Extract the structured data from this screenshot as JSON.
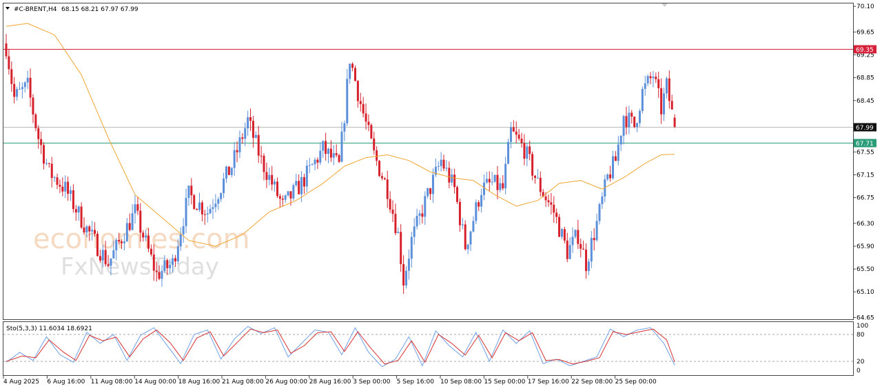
{
  "header": {
    "symbol_label": "#C-BRENT,H4",
    "ohlc_label": "68.15 68.21 67.97 67.99"
  },
  "oscillator": {
    "label": "Sto(5,3,3) 11.6034 18.6921",
    "levels": [
      "80",
      "20"
    ],
    "scale_labels": [
      "100",
      "80",
      "20",
      "0"
    ]
  },
  "watermark": {
    "brand": "economies.com",
    "sub": "FxNewsToday"
  },
  "colors": {
    "bull": "#5b8fd9",
    "bear": "#d6202b",
    "ma": "#f0a531",
    "stoch_main": "#6fa0e6",
    "stoch_signal": "#d63030",
    "resistance": "#d6213a",
    "support": "#2a9d78",
    "current": "#111111"
  },
  "chart_data": {
    "type": "candlestick",
    "instrument": "#C-BRENT",
    "timeframe": "H4",
    "y_ticks": [
      "70.10",
      "69.65",
      "69.25",
      "68.85",
      "68.45",
      "67.55",
      "67.15",
      "66.75",
      "66.30",
      "65.90",
      "65.50",
      "65.10",
      "64.65"
    ],
    "ylim": [
      64.62,
      70.15
    ],
    "x_labels": [
      "4 Aug 2025",
      "6 Aug 16:00",
      "11 Aug 08:00",
      "14 Aug 00:00",
      "18 Aug 16:00",
      "21 Aug 08:00",
      "26 Aug 00:00",
      "28 Aug 16:00",
      "3 Sep 00:00",
      "5 Sep 16:00",
      "10 Sep 08:00",
      "15 Sep 00:00",
      "17 Sep 16:00",
      "22 Sep 08:00",
      "25 Sep 00:00"
    ],
    "levels": [
      {
        "value": 69.35,
        "label": "69.35",
        "kind": "resistance"
      },
      {
        "value": 67.99,
        "label": "67.99",
        "kind": "current"
      },
      {
        "value": 67.71,
        "label": "67.71",
        "kind": "support"
      }
    ],
    "last_candle": {
      "open": 68.15,
      "high": 68.21,
      "low": 67.97,
      "close": 67.99
    },
    "close_path": [
      [
        0,
        69.4
      ],
      [
        3,
        68.5
      ],
      [
        8,
        68.7
      ],
      [
        12,
        67.8
      ],
      [
        16,
        67.2
      ],
      [
        22,
        66.9
      ],
      [
        30,
        66.2
      ],
      [
        38,
        65.6
      ],
      [
        48,
        66.5
      ],
      [
        56,
        65.4
      ],
      [
        62,
        65.6
      ],
      [
        68,
        66.8
      ],
      [
        75,
        66.5
      ],
      [
        84,
        67.3
      ],
      [
        90,
        68.1
      ],
      [
        95,
        67.4
      ],
      [
        103,
        66.6
      ],
      [
        110,
        67.0
      ],
      [
        118,
        67.6
      ],
      [
        124,
        67.3
      ],
      [
        126,
        68.2
      ],
      [
        128,
        69.2
      ],
      [
        132,
        68.4
      ],
      [
        137,
        67.5
      ],
      [
        142,
        66.9
      ],
      [
        146,
        66.1
      ],
      [
        148,
        65.3
      ],
      [
        151,
        66.0
      ],
      [
        157,
        66.8
      ],
      [
        162,
        67.4
      ],
      [
        167,
        66.9
      ],
      [
        171,
        65.9
      ],
      [
        173,
        66.2
      ],
      [
        177,
        66.9
      ],
      [
        181,
        67.0
      ],
      [
        185,
        66.9
      ],
      [
        188,
        67.9
      ],
      [
        193,
        67.6
      ],
      [
        198,
        67.0
      ],
      [
        204,
        66.5
      ],
      [
        209,
        65.8
      ],
      [
        213,
        66.1
      ],
      [
        216,
        65.6
      ],
      [
        220,
        66.3
      ],
      [
        224,
        67.1
      ],
      [
        227,
        67.4
      ],
      [
        230,
        68.2
      ],
      [
        234,
        68.0
      ],
      [
        237,
        68.6
      ],
      [
        241,
        68.9
      ],
      [
        244,
        68.3
      ],
      [
        246,
        68.7
      ],
      [
        249,
        67.99
      ]
    ],
    "ma_path": [
      [
        0,
        69.75
      ],
      [
        8,
        69.8
      ],
      [
        18,
        69.6
      ],
      [
        28,
        68.9
      ],
      [
        38,
        67.8
      ],
      [
        48,
        66.8
      ],
      [
        58,
        66.4
      ],
      [
        68,
        66.0
      ],
      [
        78,
        65.9
      ],
      [
        88,
        66.1
      ],
      [
        98,
        66.5
      ],
      [
        108,
        66.7
      ],
      [
        118,
        67.0
      ],
      [
        126,
        67.3
      ],
      [
        134,
        67.45
      ],
      [
        142,
        67.5
      ],
      [
        150,
        67.4
      ],
      [
        158,
        67.2
      ],
      [
        166,
        67.1
      ],
      [
        174,
        67.05
      ],
      [
        182,
        66.8
      ],
      [
        190,
        66.6
      ],
      [
        198,
        66.7
      ],
      [
        206,
        67.0
      ],
      [
        214,
        67.05
      ],
      [
        222,
        66.9
      ],
      [
        230,
        67.1
      ],
      [
        238,
        67.35
      ],
      [
        244,
        67.5
      ],
      [
        249,
        67.51
      ]
    ],
    "stochastic": {
      "period": "5,3,3",
      "main": 11.6034,
      "signal": 18.6921,
      "ylim": [
        0,
        100
      ],
      "levels": [
        80,
        20
      ],
      "main_path": [
        [
          0,
          18
        ],
        [
          5,
          40
        ],
        [
          10,
          22
        ],
        [
          15,
          75
        ],
        [
          20,
          35
        ],
        [
          25,
          18
        ],
        [
          30,
          85
        ],
        [
          35,
          60
        ],
        [
          40,
          80
        ],
        [
          45,
          22
        ],
        [
          50,
          78
        ],
        [
          55,
          95
        ],
        [
          60,
          55
        ],
        [
          65,
          15
        ],
        [
          70,
          80
        ],
        [
          75,
          90
        ],
        [
          80,
          25
        ],
        [
          85,
          70
        ],
        [
          90,
          98
        ],
        [
          95,
          82
        ],
        [
          100,
          95
        ],
        [
          105,
          30
        ],
        [
          110,
          60
        ],
        [
          115,
          90
        ],
        [
          120,
          85
        ],
        [
          125,
          35
        ],
        [
          130,
          95
        ],
        [
          135,
          40
        ],
        [
          140,
          8
        ],
        [
          145,
          25
        ],
        [
          150,
          75
        ],
        [
          155,
          10
        ],
        [
          160,
          88
        ],
        [
          165,
          55
        ],
        [
          170,
          30
        ],
        [
          175,
          85
        ],
        [
          180,
          20
        ],
        [
          185,
          90
        ],
        [
          190,
          60
        ],
        [
          195,
          88
        ],
        [
          200,
          15
        ],
        [
          205,
          25
        ],
        [
          210,
          10
        ],
        [
          215,
          20
        ],
        [
          220,
          30
        ],
        [
          225,
          92
        ],
        [
          230,
          75
        ],
        [
          235,
          90
        ],
        [
          240,
          95
        ],
        [
          245,
          60
        ],
        [
          249,
          11.6
        ]
      ],
      "signal_path": [
        [
          0,
          20
        ],
        [
          6,
          32
        ],
        [
          11,
          28
        ],
        [
          16,
          68
        ],
        [
          21,
          42
        ],
        [
          26,
          22
        ],
        [
          31,
          78
        ],
        [
          36,
          66
        ],
        [
          41,
          74
        ],
        [
          46,
          30
        ],
        [
          51,
          70
        ],
        [
          56,
          90
        ],
        [
          61,
          62
        ],
        [
          66,
          22
        ],
        [
          71,
          72
        ],
        [
          76,
          86
        ],
        [
          81,
          32
        ],
        [
          86,
          62
        ],
        [
          91,
          92
        ],
        [
          96,
          84
        ],
        [
          101,
          90
        ],
        [
          106,
          38
        ],
        [
          111,
          55
        ],
        [
          116,
          84
        ],
        [
          121,
          86
        ],
        [
          126,
          42
        ],
        [
          131,
          86
        ],
        [
          136,
          48
        ],
        [
          141,
          14
        ],
        [
          146,
          22
        ],
        [
          151,
          66
        ],
        [
          156,
          18
        ],
        [
          161,
          80
        ],
        [
          166,
          60
        ],
        [
          171,
          34
        ],
        [
          176,
          78
        ],
        [
          181,
          28
        ],
        [
          186,
          84
        ],
        [
          191,
          66
        ],
        [
          196,
          84
        ],
        [
          201,
          22
        ],
        [
          206,
          24
        ],
        [
          211,
          14
        ],
        [
          216,
          20
        ],
        [
          221,
          28
        ],
        [
          226,
          86
        ],
        [
          231,
          80
        ],
        [
          236,
          86
        ],
        [
          241,
          92
        ],
        [
          246,
          68
        ],
        [
          249,
          18.7
        ]
      ]
    }
  }
}
